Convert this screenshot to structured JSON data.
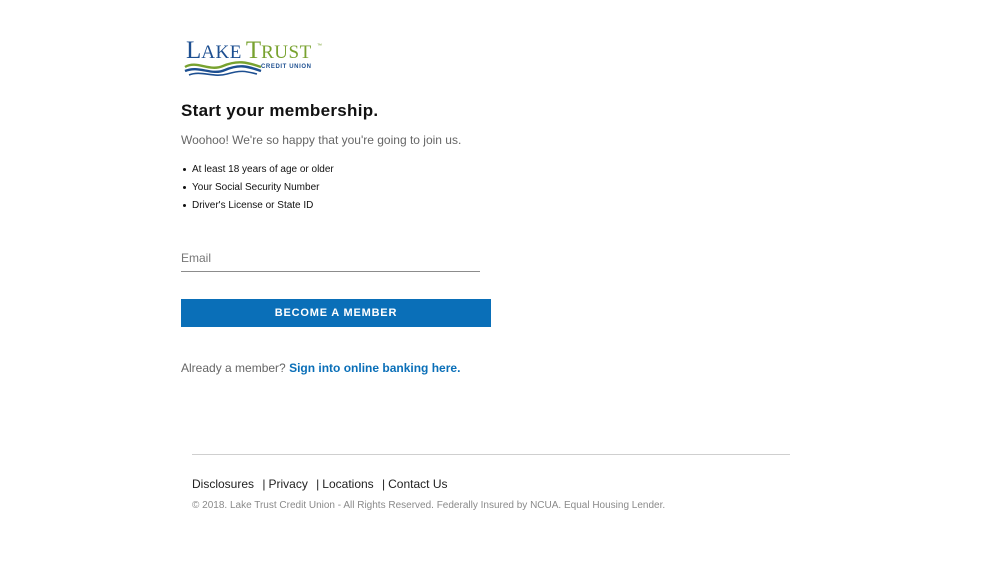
{
  "logo": {
    "word_lake_initial": "L",
    "word_lake_rest": "AKE",
    "word_trust_initial": "T",
    "word_trust_rest": "RUST",
    "trademark": "™",
    "subtitle": "CREDIT UNION",
    "colors": {
      "blue": "#1d4f91",
      "green": "#78a22f"
    }
  },
  "main": {
    "title": "Start your membership.",
    "intro": "Woohoo! We're so happy that you're going to join us.",
    "requirements": [
      "At least 18 years of age or older",
      "Your Social Security Number",
      "Driver's License or State ID"
    ],
    "email": {
      "placeholder": "Email",
      "value": ""
    },
    "become_button": "BECOME A MEMBER",
    "already_text": "Already a member?",
    "sign_in_link": "Sign into online banking here."
  },
  "footer": {
    "links": [
      "Disclosures",
      "Privacy",
      "Locations",
      "Contact Us"
    ],
    "separator": "|",
    "copyright": "© 2018. Lake Trust Credit Union - All Rights Reserved. Federally Insured by NCUA. Equal Housing Lender."
  },
  "colors": {
    "accent": "#0a6fb8",
    "button_text": "#ffffff"
  }
}
